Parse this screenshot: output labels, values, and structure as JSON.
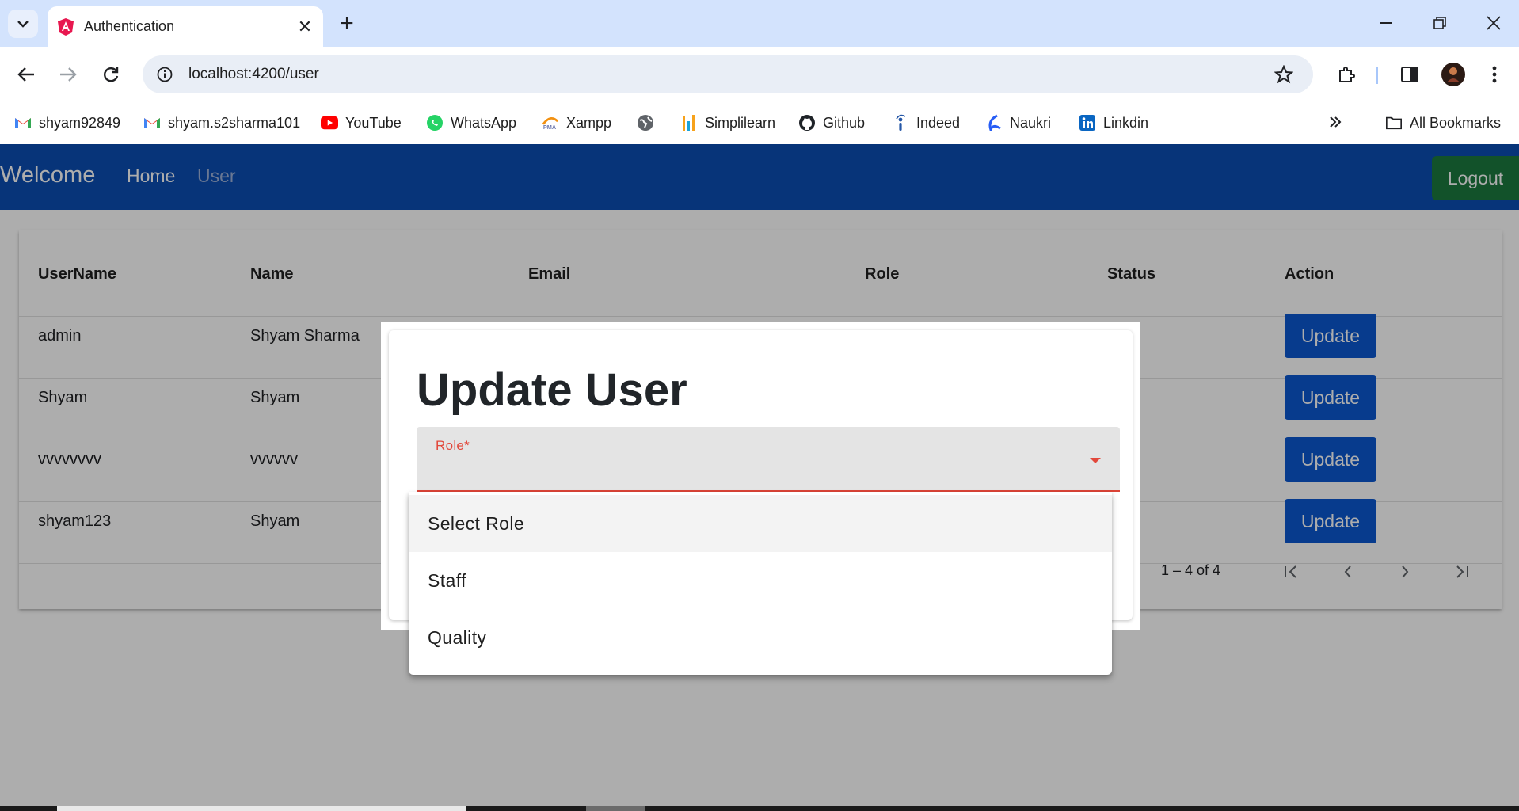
{
  "browser": {
    "tab_title": "Authentication",
    "url": "localhost:4200/user",
    "bookmarks": [
      {
        "label": "shyam92849",
        "icon": "gmail-icon"
      },
      {
        "label": "shyam.s2sharma101",
        "icon": "gmail-icon"
      },
      {
        "label": "YouTube",
        "icon": "youtube-icon"
      },
      {
        "label": "WhatsApp",
        "icon": "whatsapp-icon"
      },
      {
        "label": "Xampp",
        "icon": "phpmyadmin-icon"
      },
      {
        "label": "",
        "icon": "globe-icon"
      },
      {
        "label": "Simplilearn",
        "icon": "simplilearn-icon"
      },
      {
        "label": "Github",
        "icon": "github-icon"
      },
      {
        "label": "Indeed",
        "icon": "indeed-icon"
      },
      {
        "label": "Naukri",
        "icon": "naukri-icon"
      },
      {
        "label": "Linkdin",
        "icon": "linkedin-icon"
      }
    ],
    "all_bookmarks": "All Bookmarks"
  },
  "app": {
    "brand": "Welcome",
    "nav": {
      "home": "Home",
      "user": "User"
    },
    "logout": "Logout"
  },
  "table": {
    "headers": [
      "UserName",
      "Name",
      "Email",
      "Role",
      "Status",
      "Action"
    ],
    "rows": [
      {
        "username": "admin",
        "name": "Shyam Sharma",
        "action": "Update"
      },
      {
        "username": "Shyam",
        "name": "Shyam",
        "action": "Update"
      },
      {
        "username": "vvvvvvvv",
        "name": "vvvvvv",
        "action": "Update"
      },
      {
        "username": "shyam123",
        "name": "Shyam",
        "action": "Update"
      }
    ],
    "pager": "1 – 4 of 4"
  },
  "dialog": {
    "title": "Update User",
    "role_label": "Role*",
    "options": [
      "Select Role",
      "Staff",
      "Quality"
    ]
  },
  "colors": {
    "navbar": "#0b4db3",
    "logout": "#1b7a3f",
    "update_button": "#0b57d0",
    "error": "#e2483b"
  }
}
